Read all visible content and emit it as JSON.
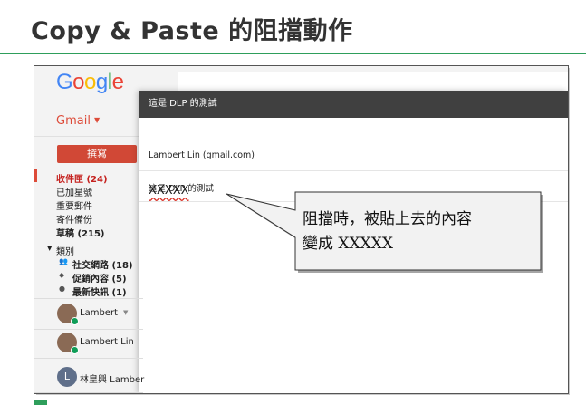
{
  "slide": {
    "title": "Copy & Paste 的阻擋動作"
  },
  "gmail": {
    "logo_letters": [
      {
        "char": "G",
        "color": "#4285f4"
      },
      {
        "char": "o",
        "color": "#ea4335"
      },
      {
        "char": "o",
        "color": "#fbbc05"
      },
      {
        "char": "g",
        "color": "#4285f4"
      },
      {
        "char": "l",
        "color": "#34a853"
      },
      {
        "char": "e",
        "color": "#ea4335"
      }
    ],
    "app_label": "Gmail",
    "compose_button": "撰寫",
    "nav_items": [
      {
        "label": "收件匣 (24)",
        "bold": true,
        "color": "#c5221f"
      },
      {
        "label": "已加星號",
        "bold": false,
        "color": "#222222"
      },
      {
        "label": "重要郵件",
        "bold": false,
        "color": "#222222"
      },
      {
        "label": "寄件備份",
        "bold": false,
        "color": "#222222"
      },
      {
        "label": "草稿 (215)",
        "bold": true,
        "color": "#222222"
      }
    ],
    "categories_label": "類別",
    "categories": [
      {
        "icon": "people-icon",
        "label": "社交網路 (18)"
      },
      {
        "icon": "tag-icon",
        "label": "促銷內容 (5)"
      },
      {
        "icon": "info-icon",
        "label": "最新快訊 (1)"
      }
    ],
    "people": [
      {
        "name": "Lambert",
        "has_caret": true
      },
      {
        "name": "Lambert Lin",
        "has_caret": false
      },
      {
        "name": "林皇興 Lamber",
        "initial": "L",
        "has_caret": false
      }
    ]
  },
  "compose": {
    "header_title": "這是 DLP 的測試",
    "from_value": "Lambert Lin (gmail.com)",
    "subject_value": "這是 DLP 的測試",
    "body_value": "XXXXX"
  },
  "callout": {
    "line1": "阻擋時，被貼上去的內容",
    "line2": "變成 XXXXX"
  }
}
